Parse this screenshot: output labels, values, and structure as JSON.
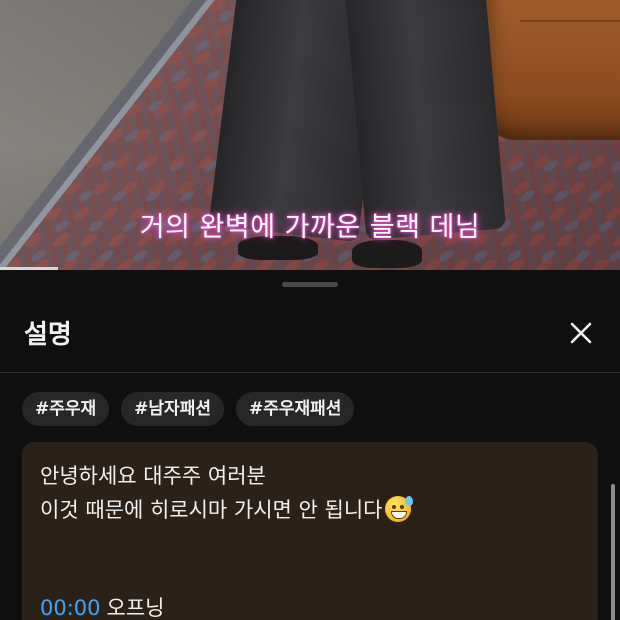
{
  "video": {
    "caption": "거의 완벽에 가까운 블랙 데님"
  },
  "sheet": {
    "title": "설명",
    "close_icon": "close-icon",
    "hashtags": [
      "#주우재",
      "#남자패션",
      "#주우재패션"
    ],
    "description": {
      "line1": "안녕하세요 대주주 여러분",
      "line2": "이것 때문에 히로시마 가시면 안 됩니다",
      "emoji": "grinning-face-with-sweat-icon"
    },
    "chapters": [
      {
        "timestamp": "00:00",
        "label": "오프닝"
      }
    ]
  },
  "colors": {
    "background": "#0f0f0f",
    "description_box": "#2b2118",
    "tag_bg": "#272727",
    "link": "#3ea6ff",
    "caption_glow": "#ff4fd0"
  }
}
